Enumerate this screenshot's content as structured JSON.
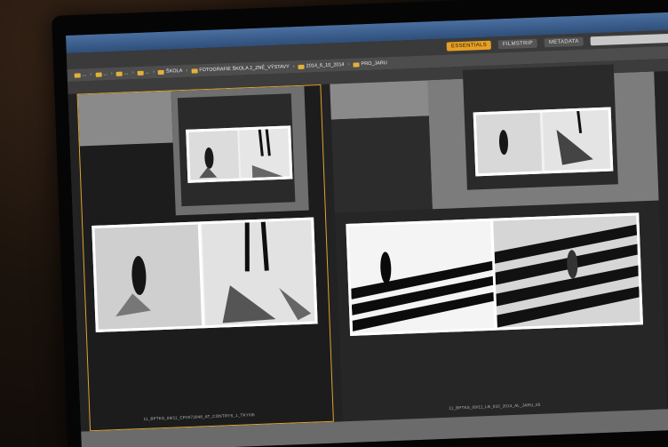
{
  "workspace": {
    "buttons": [
      {
        "label": "ESSENTIALS",
        "active": true
      },
      {
        "label": "FILMSTRIP",
        "active": false
      },
      {
        "label": "METADATA",
        "active": false
      }
    ]
  },
  "path": {
    "items": [
      "...",
      "...",
      "...",
      "...",
      "ŠKOLA",
      "FOTOGRAFIE ŠKOLA 2_ZNÉ_VÝSTAVY",
      "2014_6_10_2014",
      "PRO_JARU"
    ]
  },
  "thumbnails": {
    "left_filename": "11_BPTKS_09/11_CP2073048_AT_CONTRYS_1_TKY/06",
    "right_filename": "11_BPTKS_09/11_LB_010_2014_AL_JARU_05"
  },
  "colors": {
    "selection": "#e0a530",
    "active_workspace": "#e8a020",
    "folder": "#e3b13a"
  }
}
